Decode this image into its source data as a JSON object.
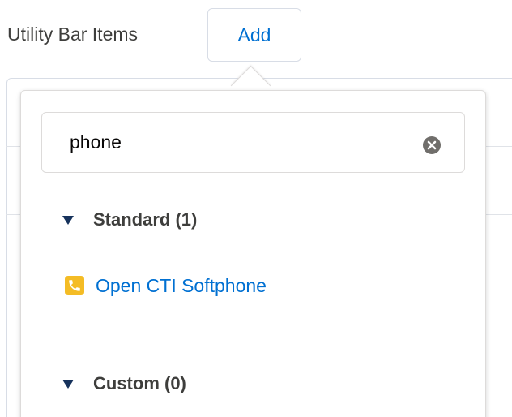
{
  "header": {
    "title": "Utility Bar Items",
    "add_label": "Add"
  },
  "search": {
    "value": "phone",
    "clear_icon": "clear-icon"
  },
  "sections": [
    {
      "title": "Standard (1)",
      "expanded": true,
      "items": [
        {
          "label": "Open CTI Softphone",
          "icon": "phone-icon",
          "icon_color": "#f4bc25"
        }
      ]
    },
    {
      "title": "Custom (0)",
      "expanded": true,
      "items": []
    }
  ],
  "colors": {
    "link": "#0070d2",
    "text": "#3e3e3c",
    "border": "#dddbda",
    "icon_bg": "#f4bc25"
  }
}
